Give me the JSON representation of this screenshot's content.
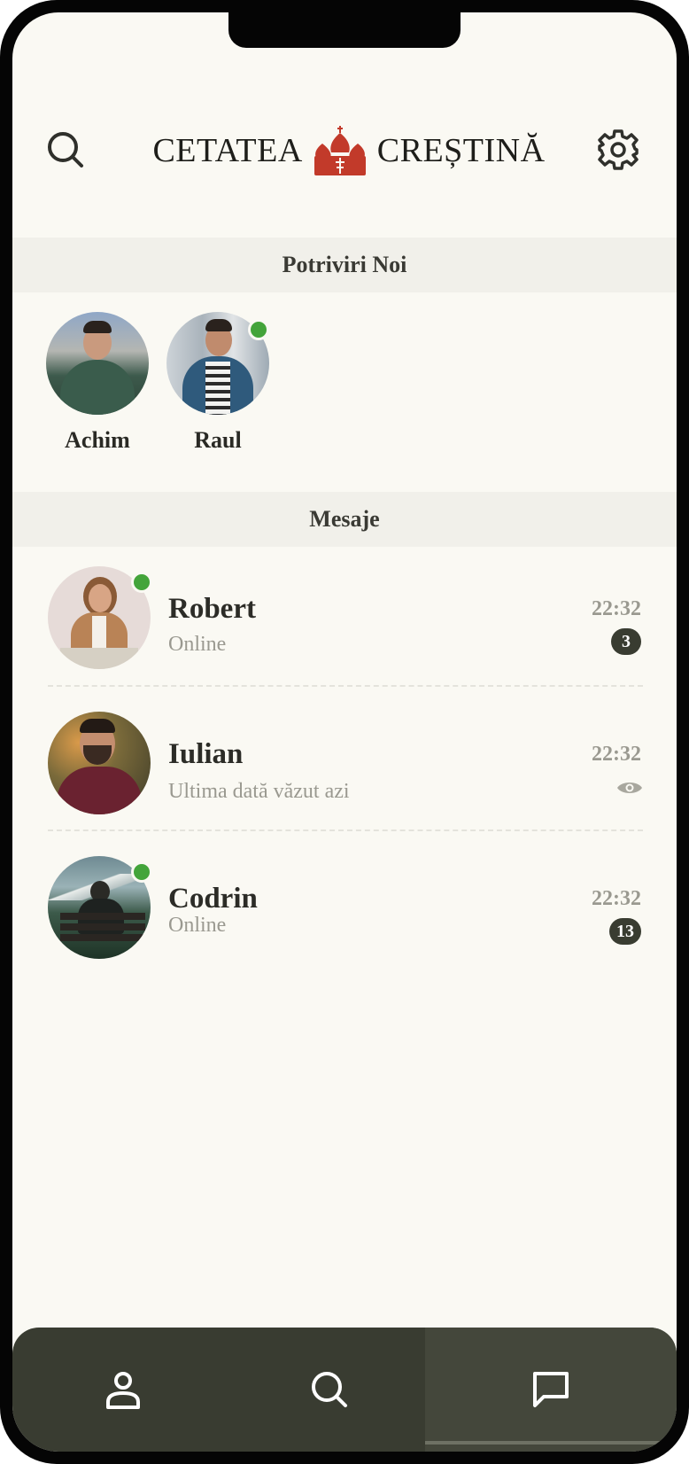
{
  "header": {
    "logo_left": "CETATEA",
    "logo_right": "CREȘTINĂ",
    "icons": {
      "search": "search-icon",
      "settings": "gear-icon",
      "logo": "church-domes-icon"
    },
    "colors": {
      "logo_accent": "#c23a2a"
    }
  },
  "matches_section": {
    "title": "Potriviri Noi",
    "items": [
      {
        "name": "Achim",
        "online": false
      },
      {
        "name": "Raul",
        "online": true
      }
    ]
  },
  "messages_section": {
    "title": "Mesaje",
    "conversations": [
      {
        "name": "Robert",
        "status": "Online",
        "time": "22:32",
        "unread": "3",
        "online": true
      },
      {
        "name": "Iulian",
        "status": "Ultima dată văzut azi",
        "time": "22:32",
        "seen_icon": "eye-icon",
        "online": false
      },
      {
        "name": "Codrin",
        "status": "Online",
        "time": "22:32",
        "unread": "13",
        "online": true
      }
    ]
  },
  "bottom_nav": {
    "items": [
      {
        "icon": "user-icon"
      },
      {
        "icon": "search-icon"
      },
      {
        "icon": "chat-bubble-icon",
        "active": true
      }
    ]
  },
  "colors": {
    "background": "#faf9f3",
    "section_bar": "#f1f0ea",
    "nav": "#393c31",
    "online": "#43a43a",
    "muted_text": "#9a9990"
  }
}
